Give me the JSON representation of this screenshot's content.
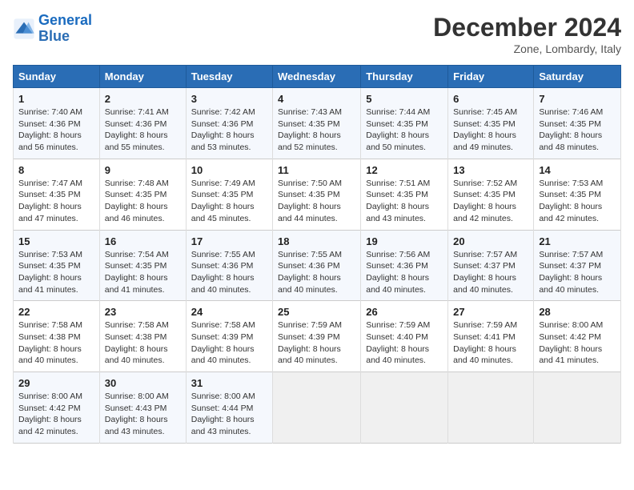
{
  "header": {
    "logo_line1": "General",
    "logo_line2": "Blue",
    "title": "December 2024",
    "subtitle": "Zone, Lombardy, Italy"
  },
  "columns": [
    "Sunday",
    "Monday",
    "Tuesday",
    "Wednesday",
    "Thursday",
    "Friday",
    "Saturday"
  ],
  "weeks": [
    [
      {
        "day": "1",
        "sunrise": "7:40 AM",
        "sunset": "4:36 PM",
        "daylight": "8 hours and 56 minutes."
      },
      {
        "day": "2",
        "sunrise": "7:41 AM",
        "sunset": "4:36 PM",
        "daylight": "8 hours and 55 minutes."
      },
      {
        "day": "3",
        "sunrise": "7:42 AM",
        "sunset": "4:36 PM",
        "daylight": "8 hours and 53 minutes."
      },
      {
        "day": "4",
        "sunrise": "7:43 AM",
        "sunset": "4:35 PM",
        "daylight": "8 hours and 52 minutes."
      },
      {
        "day": "5",
        "sunrise": "7:44 AM",
        "sunset": "4:35 PM",
        "daylight": "8 hours and 50 minutes."
      },
      {
        "day": "6",
        "sunrise": "7:45 AM",
        "sunset": "4:35 PM",
        "daylight": "8 hours and 49 minutes."
      },
      {
        "day": "7",
        "sunrise": "7:46 AM",
        "sunset": "4:35 PM",
        "daylight": "8 hours and 48 minutes."
      }
    ],
    [
      {
        "day": "8",
        "sunrise": "7:47 AM",
        "sunset": "4:35 PM",
        "daylight": "8 hours and 47 minutes."
      },
      {
        "day": "9",
        "sunrise": "7:48 AM",
        "sunset": "4:35 PM",
        "daylight": "8 hours and 46 minutes."
      },
      {
        "day": "10",
        "sunrise": "7:49 AM",
        "sunset": "4:35 PM",
        "daylight": "8 hours and 45 minutes."
      },
      {
        "day": "11",
        "sunrise": "7:50 AM",
        "sunset": "4:35 PM",
        "daylight": "8 hours and 44 minutes."
      },
      {
        "day": "12",
        "sunrise": "7:51 AM",
        "sunset": "4:35 PM",
        "daylight": "8 hours and 43 minutes."
      },
      {
        "day": "13",
        "sunrise": "7:52 AM",
        "sunset": "4:35 PM",
        "daylight": "8 hours and 42 minutes."
      },
      {
        "day": "14",
        "sunrise": "7:53 AM",
        "sunset": "4:35 PM",
        "daylight": "8 hours and 42 minutes."
      }
    ],
    [
      {
        "day": "15",
        "sunrise": "7:53 AM",
        "sunset": "4:35 PM",
        "daylight": "8 hours and 41 minutes."
      },
      {
        "day": "16",
        "sunrise": "7:54 AM",
        "sunset": "4:35 PM",
        "daylight": "8 hours and 41 minutes."
      },
      {
        "day": "17",
        "sunrise": "7:55 AM",
        "sunset": "4:36 PM",
        "daylight": "8 hours and 40 minutes."
      },
      {
        "day": "18",
        "sunrise": "7:55 AM",
        "sunset": "4:36 PM",
        "daylight": "8 hours and 40 minutes."
      },
      {
        "day": "19",
        "sunrise": "7:56 AM",
        "sunset": "4:36 PM",
        "daylight": "8 hours and 40 minutes."
      },
      {
        "day": "20",
        "sunrise": "7:57 AM",
        "sunset": "4:37 PM",
        "daylight": "8 hours and 40 minutes."
      },
      {
        "day": "21",
        "sunrise": "7:57 AM",
        "sunset": "4:37 PM",
        "daylight": "8 hours and 40 minutes."
      }
    ],
    [
      {
        "day": "22",
        "sunrise": "7:58 AM",
        "sunset": "4:38 PM",
        "daylight": "8 hours and 40 minutes."
      },
      {
        "day": "23",
        "sunrise": "7:58 AM",
        "sunset": "4:38 PM",
        "daylight": "8 hours and 40 minutes."
      },
      {
        "day": "24",
        "sunrise": "7:58 AM",
        "sunset": "4:39 PM",
        "daylight": "8 hours and 40 minutes."
      },
      {
        "day": "25",
        "sunrise": "7:59 AM",
        "sunset": "4:39 PM",
        "daylight": "8 hours and 40 minutes."
      },
      {
        "day": "26",
        "sunrise": "7:59 AM",
        "sunset": "4:40 PM",
        "daylight": "8 hours and 40 minutes."
      },
      {
        "day": "27",
        "sunrise": "7:59 AM",
        "sunset": "4:41 PM",
        "daylight": "8 hours and 40 minutes."
      },
      {
        "day": "28",
        "sunrise": "8:00 AM",
        "sunset": "4:42 PM",
        "daylight": "8 hours and 41 minutes."
      }
    ],
    [
      {
        "day": "29",
        "sunrise": "8:00 AM",
        "sunset": "4:42 PM",
        "daylight": "8 hours and 42 minutes."
      },
      {
        "day": "30",
        "sunrise": "8:00 AM",
        "sunset": "4:43 PM",
        "daylight": "8 hours and 43 minutes."
      },
      {
        "day": "31",
        "sunrise": "8:00 AM",
        "sunset": "4:44 PM",
        "daylight": "8 hours and 43 minutes."
      },
      null,
      null,
      null,
      null
    ]
  ]
}
